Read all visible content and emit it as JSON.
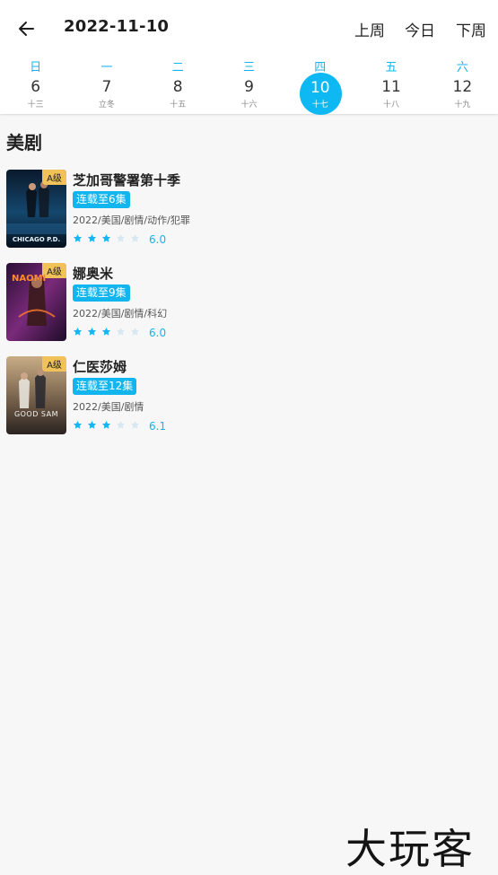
{
  "header": {
    "date": "2022-11-10",
    "prev_week": "上周",
    "today": "今日",
    "next_week": "下周"
  },
  "week": [
    {
      "weekday": "日",
      "day": "6",
      "lunar": "十三",
      "selected": false
    },
    {
      "weekday": "一",
      "day": "7",
      "lunar": "立冬",
      "selected": false
    },
    {
      "weekday": "二",
      "day": "8",
      "lunar": "十五",
      "selected": false
    },
    {
      "weekday": "三",
      "day": "9",
      "lunar": "十六",
      "selected": false
    },
    {
      "weekday": "四",
      "day": "10",
      "lunar": "十七",
      "selected": true
    },
    {
      "weekday": "五",
      "day": "11",
      "lunar": "十八",
      "selected": false
    },
    {
      "weekday": "六",
      "day": "12",
      "lunar": "十九",
      "selected": false
    }
  ],
  "section": {
    "title": "美剧"
  },
  "shows": [
    {
      "title": "芝加哥警署第十季",
      "episode": "连载至6集",
      "meta": "2022/美国/剧情/动作/犯罪",
      "grade": "A级",
      "score": "6.0",
      "stars_filled": 3,
      "stars_total": 5,
      "poster_text": "CHICAGO P.D."
    },
    {
      "title": "娜奥米",
      "episode": "连载至9集",
      "meta": "2022/美国/剧情/科幻",
      "grade": "A级",
      "score": "6.0",
      "stars_filled": 3,
      "stars_total": 5,
      "poster_text": "NAOMI"
    },
    {
      "title": "仁医莎姆",
      "episode": "连载至12集",
      "meta": "2022/美国/剧情",
      "grade": "A级",
      "score": "6.1",
      "stars_filled": 3,
      "stars_total": 5,
      "poster_text": "GOOD SAM"
    }
  ],
  "watermark": "大玩客",
  "colors": {
    "accent": "#12b5ee",
    "grade_badge": "#f1c25a",
    "star_empty": "#d6e8f4"
  },
  "icons": {
    "back": "arrow-left-icon",
    "star": "star-icon"
  }
}
